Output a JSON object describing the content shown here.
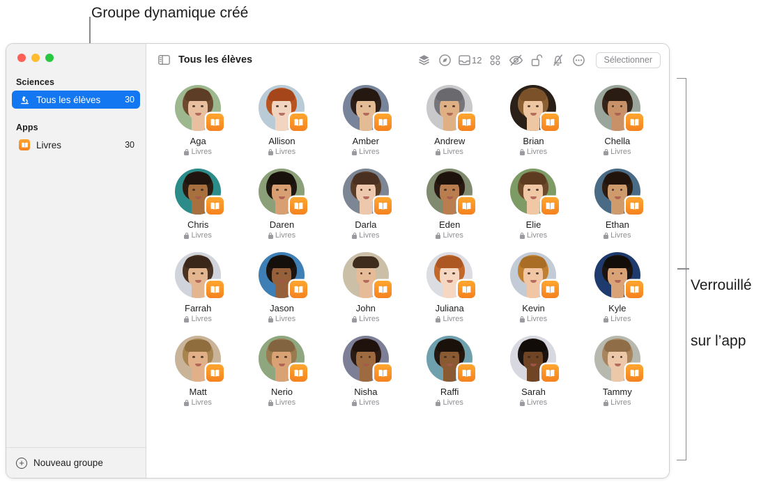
{
  "annotations": {
    "top_callout": "Groupe dynamique créé",
    "right_callout_line1": "Verrouillé",
    "right_callout_line2": "sur l’app"
  },
  "window": {
    "traffic_lights": [
      "close",
      "minimize",
      "zoom"
    ]
  },
  "sidebar": {
    "sections": [
      {
        "header": "Sciences",
        "items": [
          {
            "icon": "microscope-icon",
            "label": "Tous les élèves",
            "count": "30",
            "selected": true
          }
        ]
      },
      {
        "header": "Apps",
        "items": [
          {
            "icon": "books-app-icon",
            "label": "Livres",
            "count": "30",
            "selected": false
          }
        ]
      }
    ],
    "footer": {
      "icon": "plus-circle-icon",
      "label": "Nouveau groupe"
    }
  },
  "toolbar": {
    "sidebar_toggle_icon": "sidebar-toggle-icon",
    "title": "Tous les élèves",
    "actions": [
      {
        "icon": "layers-icon",
        "name": "layers-button"
      },
      {
        "icon": "navigate-icon",
        "name": "navigate-button"
      },
      {
        "icon": "tray-icon",
        "name": "tray-button",
        "badge": "12"
      },
      {
        "icon": "grid-icon",
        "name": "grid-view-button"
      },
      {
        "icon": "eye-slash-icon",
        "name": "hide-screen-button"
      },
      {
        "icon": "lock-open-icon",
        "name": "unlock-button"
      },
      {
        "icon": "bell-slash-icon",
        "name": "mute-button"
      },
      {
        "icon": "ellipsis-circle-icon",
        "name": "more-options-button"
      }
    ],
    "select_button": "Sélectionner"
  },
  "students": [
    {
      "name": "Aga",
      "app": "Livres",
      "bg": "#9db88e",
      "hair": "#6d4a2f",
      "skin": "#e8c0a0",
      "fringe": "#5d3d25"
    },
    {
      "name": "Allison",
      "app": "Livres",
      "bg": "#b8cbd6",
      "hair": "#b9531f",
      "skin": "#f2d5c0",
      "fringe": "#a4461a"
    },
    {
      "name": "Amber",
      "app": "Livres",
      "bg": "#77849a",
      "hair": "#2e2018",
      "skin": "#e3bb95",
      "fringe": "#241810"
    },
    {
      "name": "Andrew",
      "app": "Livres",
      "bg": "#c9c9cb",
      "hair": "#767579",
      "skin": "#e0b085",
      "fringe": "#6a696d"
    },
    {
      "name": "Brian",
      "app": "Livres",
      "bg": "#2a2018",
      "hair": "#8b6134",
      "skin": "#eec6a2",
      "fringe": "#7a5128"
    },
    {
      "name": "Chella",
      "app": "Livres",
      "bg": "#9aa69b",
      "hair": "#36251a",
      "skin": "#c99168",
      "fringe": "#2a1c13"
    },
    {
      "name": "Chris",
      "app": "Livres",
      "bg": "#2c8c8a",
      "hair": "#2b1d14",
      "skin": "#a8703f",
      "fringe": "#20150e"
    },
    {
      "name": "Daren",
      "app": "Livres",
      "bg": "#8ba078",
      "hair": "#1f1710",
      "skin": "#d89f72",
      "fringe": "#17100b"
    },
    {
      "name": "Darla",
      "app": "Livres",
      "bg": "#7d8694",
      "hair": "#5a3d26",
      "skin": "#edc8ad",
      "fringe": "#4a3020"
    },
    {
      "name": "Eden",
      "app": "Livres",
      "bg": "#7f8a6e",
      "hair": "#2a1a12",
      "skin": "#b97d50",
      "fringe": "#1e120c"
    },
    {
      "name": "Elie",
      "app": "Livres",
      "bg": "#7d9b64",
      "hair": "#6e4a2c",
      "skin": "#f0c8a6",
      "fringe": "#5c3b21"
    },
    {
      "name": "Ethan",
      "app": "Livres",
      "bg": "#4a6b86",
      "hair": "#2c1c12",
      "skin": "#cf9a6c",
      "fringe": "#20140d"
    },
    {
      "name": "Farrah",
      "app": "Livres",
      "bg": "#d2d4dc",
      "hair": "#4a3322",
      "skin": "#e4b690",
      "fringe": "#3a271a"
    },
    {
      "name": "Jason",
      "app": "Livres",
      "bg": "#3e7fb5",
      "hair": "#1d1510",
      "skin": "#96603a",
      "fringe": "#150f0b"
    },
    {
      "name": "John",
      "app": "Livres",
      "bg": "#cbbfa8",
      "hair": "#4f3venue",
      "skin": "#e6bc98",
      "fringe": "#3f2c1c"
    },
    {
      "name": "Juliana",
      "app": "Livres",
      "bg": "#dcdde2",
      "hair": "#c2682a",
      "skin": "#f6d8c2",
      "fringe": "#ad5722"
    },
    {
      "name": "Kevin",
      "app": "Livres",
      "bg": "#c3ccd6",
      "hair": "#c08030",
      "skin": "#f0c6a4",
      "fringe": "#a96d25"
    },
    {
      "name": "Kyle",
      "app": "Livres",
      "bg": "#1f3b6e",
      "hair": "#1b1410",
      "skin": "#d9a377",
      "fringe": "#130d0a"
    },
    {
      "name": "Matt",
      "app": "Livres",
      "bg": "#c9b49a",
      "hair": "#a8854f",
      "skin": "#e1b089",
      "fringe": "#8f6d3d"
    },
    {
      "name": "Nerio",
      "app": "Livres",
      "bg": "#8fa77f",
      "hair": "#9a7a4e",
      "skin": "#d8a274",
      "fringe": "#836440"
    },
    {
      "name": "Nisha",
      "app": "Livres",
      "bg": "#7d7f97",
      "hair": "#2b1b12",
      "skin": "#9e6a3f",
      "fringe": "#1f120c"
    },
    {
      "name": "Raffi",
      "app": "Livres",
      "bg": "#6fa0ad",
      "hair": "#241810",
      "skin": "#8a5a32",
      "fringe": "#1a110b"
    },
    {
      "name": "Sarah",
      "app": "Livres",
      "bg": "#d7d8e0",
      "hair": "#1b1310",
      "skin": "#6f4526",
      "fringe": "#120c09"
    },
    {
      "name": "Tammy",
      "app": "Livres",
      "bg": "#b7b8ae",
      "hair": "#a8855c",
      "skin": "#ecc7a8",
      "fringe": "#8f6e47"
    }
  ]
}
